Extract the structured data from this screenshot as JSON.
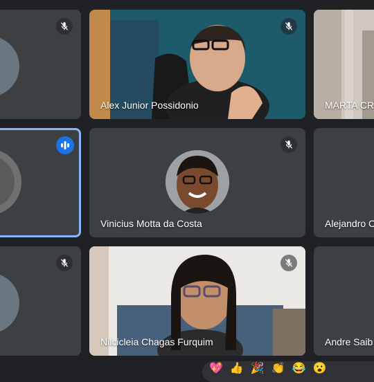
{
  "participants": [
    {
      "name": "",
      "status": "muted"
    },
    {
      "name": "Alex Junior Possidonio",
      "status": "muted"
    },
    {
      "name": "MARTA CR",
      "status": ""
    },
    {
      "name": "",
      "status": "speaking"
    },
    {
      "name": "Vinicius Motta da Costa",
      "status": "muted"
    },
    {
      "name": "Alejandro C",
      "status": ""
    },
    {
      "name": "",
      "status": "muted"
    },
    {
      "name": "Nilcicleia Chagas Furquim",
      "status": "muted"
    },
    {
      "name": "Andre Saib",
      "status": ""
    }
  ],
  "reactions": [
    "💖",
    "👍",
    "🎉",
    "👏",
    "😂",
    "😮"
  ],
  "colors": {
    "background": "#202124",
    "tile": "#3c4043",
    "active_border": "#8ab4f8",
    "speaking_badge": "#1a73e8"
  },
  "icons": {
    "muted": "mic-off-icon",
    "speaking": "audio-bars-icon"
  }
}
